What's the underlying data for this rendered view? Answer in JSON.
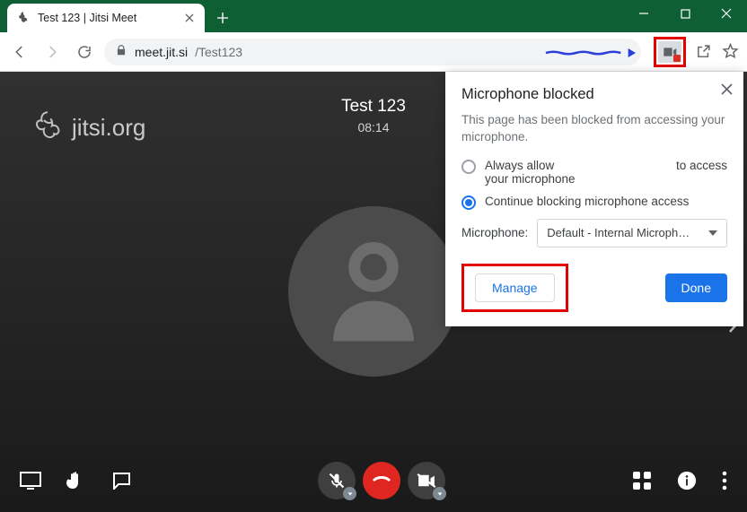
{
  "window": {
    "tab_title": "Test 123 | Jitsi Meet"
  },
  "url": {
    "host": "meet.jit.si",
    "path": "/Test123"
  },
  "jitsi": {
    "brand": "jitsi.org",
    "room_name": "Test 123",
    "clock": "08:14"
  },
  "popup": {
    "title": "Microphone blocked",
    "description": "This page has been blocked from accessing your microphone.",
    "option_allow_line1": "Always allow",
    "option_allow_line2": "your microphone",
    "option_allow_suffix": "to access",
    "option_block": "Continue blocking microphone access",
    "mic_label": "Microphone:",
    "mic_selected": "Default - Internal Microph…",
    "manage": "Manage",
    "done": "Done"
  }
}
